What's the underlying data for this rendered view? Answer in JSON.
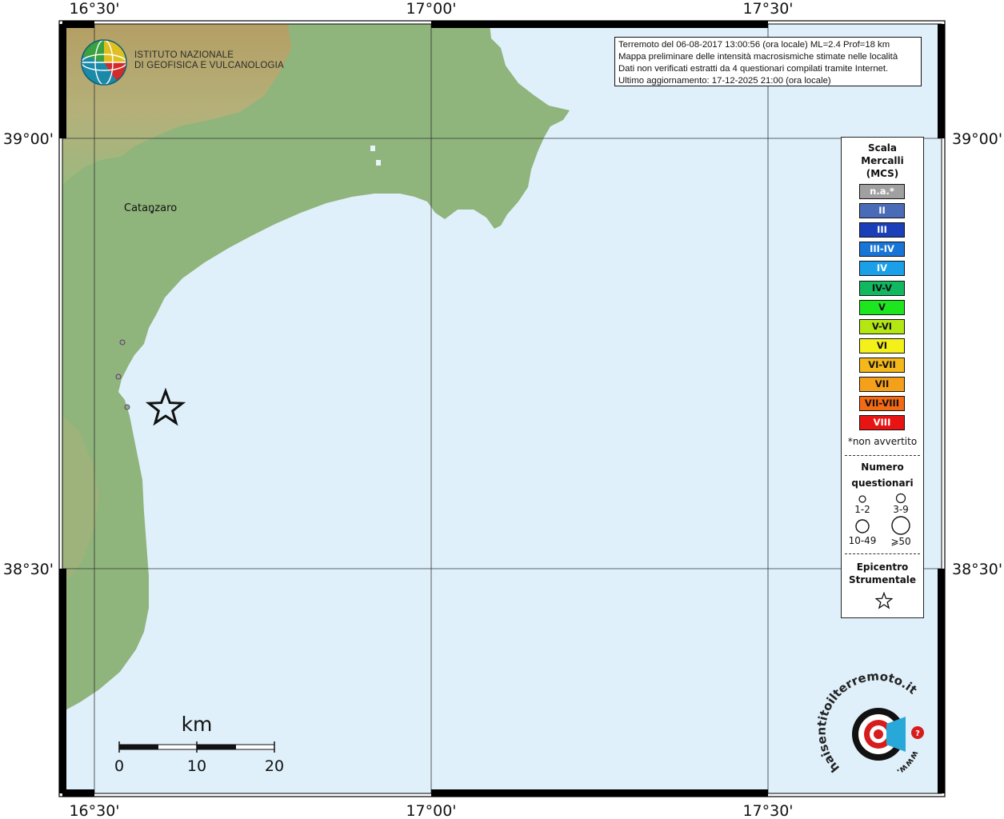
{
  "map": {
    "lon_ticks": [
      {
        "label": "16°30'"
      },
      {
        "label": "17°00'"
      },
      {
        "label": "17°30'"
      }
    ],
    "lat_ticks": [
      {
        "label": "39°00'"
      },
      {
        "label": "38°30'"
      }
    ],
    "city": {
      "name": "Catanzaro"
    },
    "colors": {
      "sea": "#dff0fb",
      "land_green": "#8fb47c",
      "relief_tan": "#b9a36c",
      "frame": "#000000"
    }
  },
  "info": {
    "line1": "Terremoto del 06-08-2017 13:00:56 (ora locale) ML=2.4 Prof=18 km",
    "line2": "Mappa preliminare delle intensità macrosismiche stimate nelle località",
    "line3": "Dati non verificati estratti da 4 questionari compilati tramite Internet.",
    "line4": "Ultimo aggiornamento: 17-12-2025 21:00 (ora locale)"
  },
  "institute": {
    "line1": "ISTITUTO NAZIONALE",
    "line2": "DI GEOFISICA E VULCANOLOGIA"
  },
  "legend": {
    "title1": "Scala",
    "title2": "Mercalli",
    "title3": "(MCS)",
    "classes": [
      {
        "label": "n.a.*",
        "color": "#a0a0a0",
        "text_color": "#ffffff"
      },
      {
        "label": "II",
        "color": "#4a6cb8",
        "text_color": "#ffffff"
      },
      {
        "label": "III",
        "color": "#1b3fb8",
        "text_color": "#ffffff"
      },
      {
        "label": "III-IV",
        "color": "#1875d8",
        "text_color": "#ffffff"
      },
      {
        "label": "IV",
        "color": "#1aa0e8",
        "text_color": "#ffffff"
      },
      {
        "label": "IV-V",
        "color": "#10b860",
        "text_color": "#111111"
      },
      {
        "label": "V",
        "color": "#1ee61e",
        "text_color": "#111111"
      },
      {
        "label": "V-VI",
        "color": "#b4e614",
        "text_color": "#111111"
      },
      {
        "label": "VI",
        "color": "#f4f01a",
        "text_color": "#111111"
      },
      {
        "label": "VI-VII",
        "color": "#f4b81a",
        "text_color": "#111111"
      },
      {
        "label": "VII",
        "color": "#f4a01a",
        "text_color": "#111111"
      },
      {
        "label": "VII-VIII",
        "color": "#f46a14",
        "text_color": "#111111"
      },
      {
        "label": "VIII",
        "color": "#e81414",
        "text_color": "#ffffff"
      }
    ],
    "not_felt_note": "*non avvertito",
    "count_title1": "Numero",
    "count_title2": "questionari",
    "sizes": [
      "1-2",
      "3-9",
      "10-49",
      "⩾50"
    ],
    "epicenter_title1": "Epicentro",
    "epicenter_title2": "Strumentale"
  },
  "scalebar": {
    "unit": "km",
    "labels": [
      "0",
      "10",
      "20"
    ]
  },
  "site_logo": {
    "text": "haisentitoilterremoto.it",
    "url": "www."
  }
}
